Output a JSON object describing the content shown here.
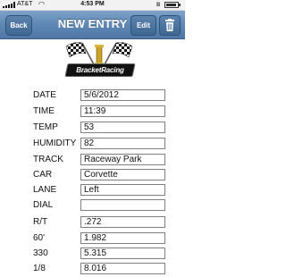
{
  "status_bar": {
    "carrier": "AT&T",
    "time": "4:53 PM"
  },
  "nav": {
    "back_label": "Back",
    "title": "NEW ENTRY",
    "edit_label": "Edit",
    "accent_color": "#5f87b4"
  },
  "logo": {
    "text": "BracketRacing"
  },
  "form": {
    "fields": [
      {
        "label": "DATE",
        "value": "5/6/2012"
      },
      {
        "label": "TIME",
        "value": "11:39"
      },
      {
        "label": "TEMP",
        "value": "53"
      },
      {
        "label": "HUMIDITY",
        "value": "82"
      },
      {
        "label": "TRACK",
        "value": "Raceway Park"
      },
      {
        "label": "CAR",
        "value": "Corvette"
      },
      {
        "label": "LANE",
        "value": "Left"
      },
      {
        "label": "DIAL",
        "value": ""
      },
      {
        "label": "R/T",
        "value": ".272"
      },
      {
        "label": "60'",
        "value": "1.982"
      },
      {
        "label": "330",
        "value": "5.315"
      },
      {
        "label": "1/8",
        "value": "8.016"
      }
    ]
  }
}
